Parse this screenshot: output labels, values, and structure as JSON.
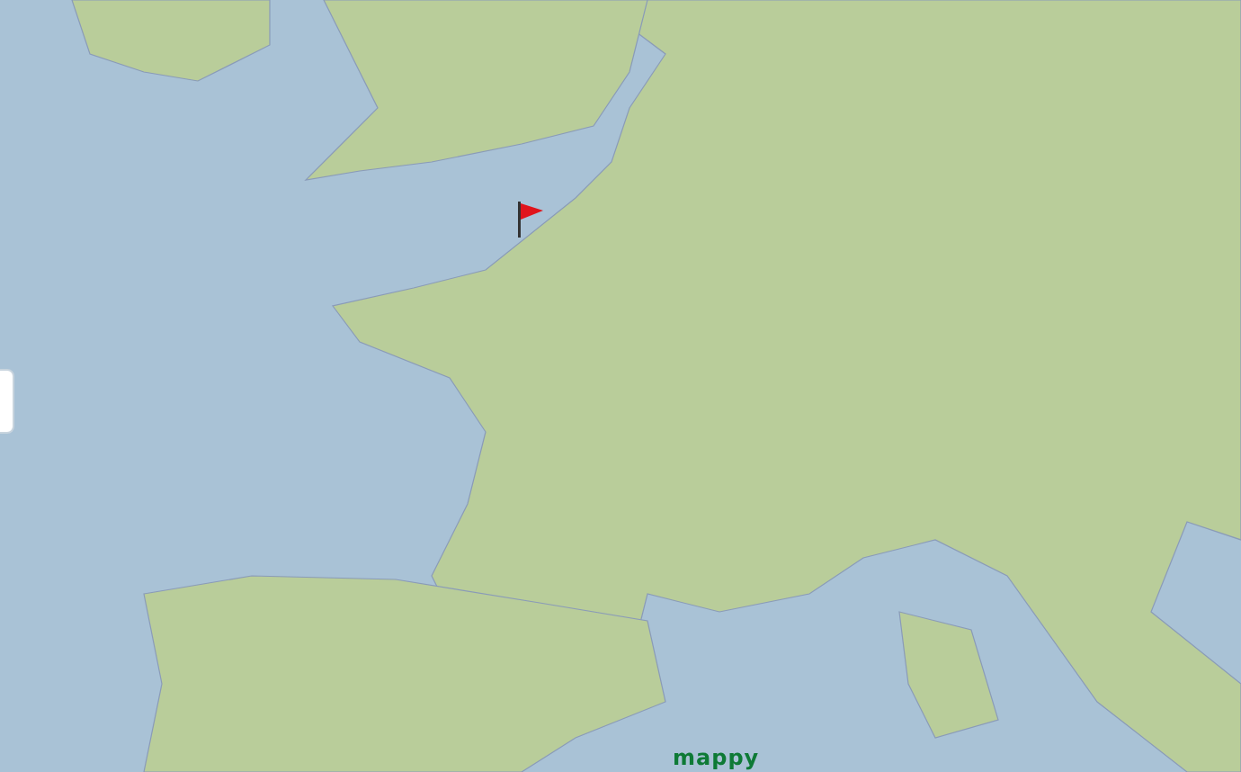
{
  "map": {
    "logo": "mappy"
  }
}
